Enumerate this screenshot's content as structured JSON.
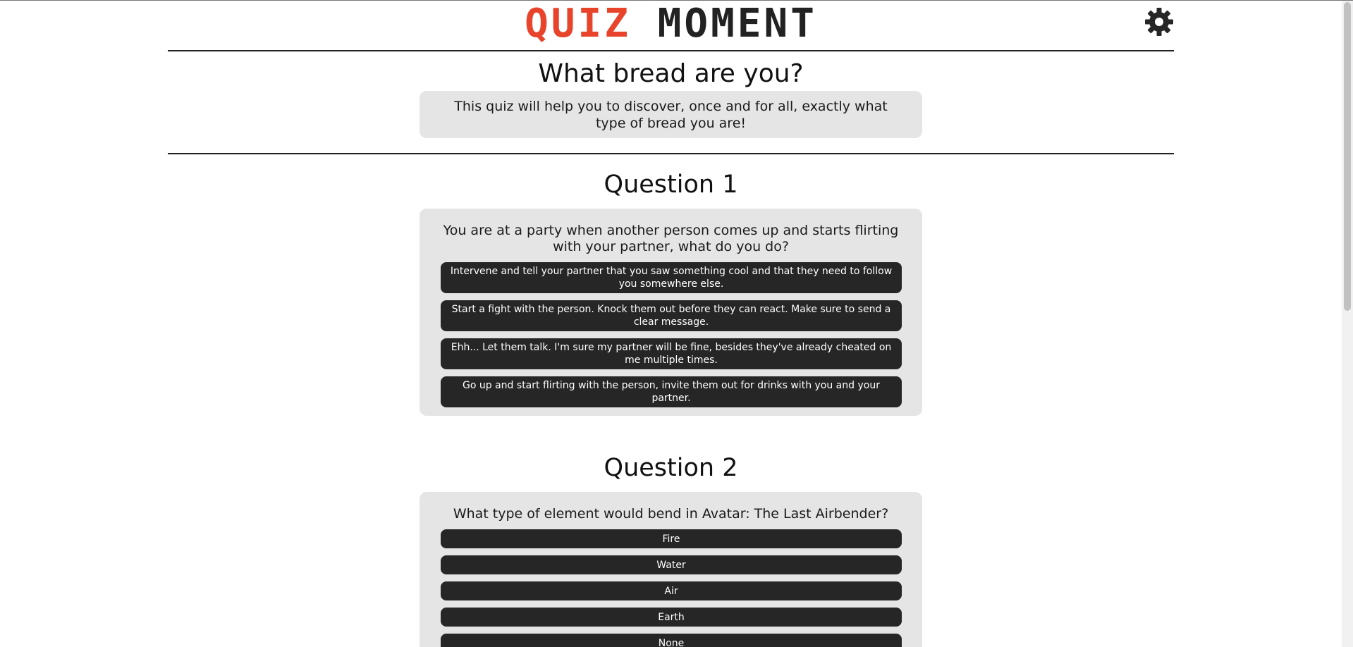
{
  "header": {
    "logo_word1": "QUIZ",
    "logo_word2": "MOMENT",
    "settings_icon": "gear-icon"
  },
  "quiz": {
    "title": "What bread are you?",
    "description": "This quiz will help you to discover, once and for all, exactly what type of bread you are!"
  },
  "questions": [
    {
      "heading": "Question 1",
      "text": "You are at a party when another person comes up and starts flirting with your partner, what do you do?",
      "answers": [
        "Intervene and tell your partner that you saw something cool and that they need to follow you somewhere else.",
        "Start a fight with the person. Knock them out before they can react. Make sure to send a clear message.",
        "Ehh... Let them talk. I'm sure my partner will be fine, besides they've already cheated on me multiple times.",
        "Go up and start flirting with the person, invite them out for drinks with you and your partner."
      ]
    },
    {
      "heading": "Question 2",
      "text": "What type of element would bend in Avatar: The Last Airbender?",
      "answers": [
        "Fire",
        "Water",
        "Air",
        "Earth",
        "None"
      ]
    }
  ],
  "colors": {
    "logo_accent": "#e8442b",
    "logo_dark": "#222222",
    "panel_bg": "#e5e5e5",
    "button_bg": "#262626"
  }
}
